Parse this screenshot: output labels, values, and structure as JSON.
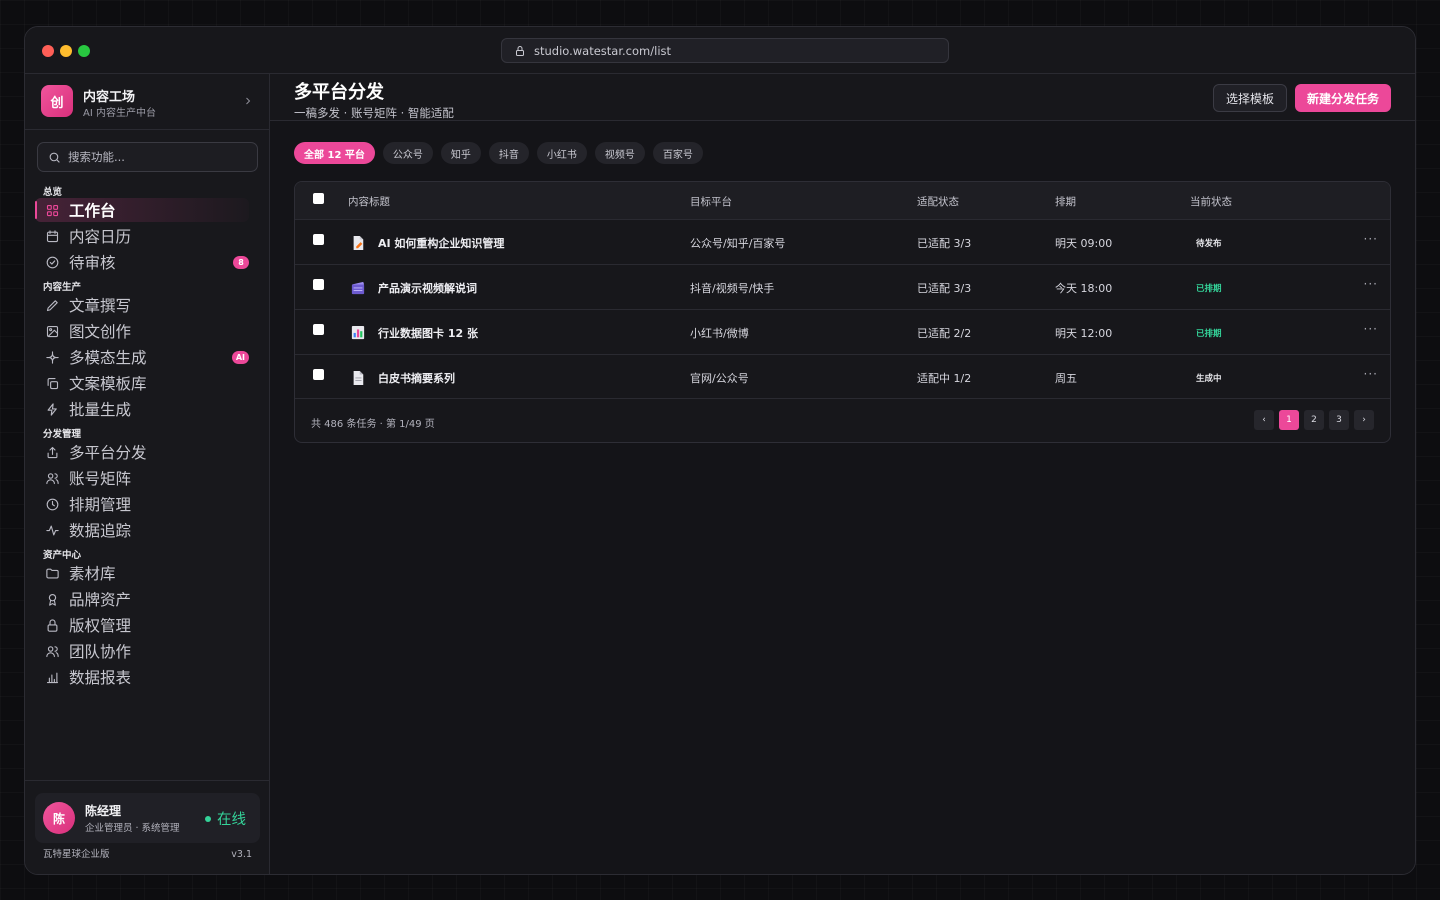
{
  "browser": {
    "url": "studio.watestar.com/list"
  },
  "brand": {
    "logo_char": "创",
    "name": "内容工场",
    "subtitle": "AI 内容生产中台"
  },
  "search": {
    "placeholder": "搜索功能..."
  },
  "nav": {
    "groups": [
      {
        "label": "总览",
        "items": [
          {
            "label": "工作台",
            "icon": "grid-icon",
            "active": true
          },
          {
            "label": "内容日历",
            "icon": "calendar-icon"
          },
          {
            "label": "待审核",
            "icon": "check-circle-icon",
            "badge": "8"
          }
        ]
      },
      {
        "label": "内容生产",
        "items": [
          {
            "label": "文章撰写",
            "icon": "pen-icon"
          },
          {
            "label": "图文创作",
            "icon": "image-icon"
          },
          {
            "label": "多模态生成",
            "icon": "sparkle-icon",
            "badge": "AI"
          },
          {
            "label": "文案模板库",
            "icon": "copy-icon"
          },
          {
            "label": "批量生成",
            "icon": "bolt-icon"
          }
        ]
      },
      {
        "label": "分发管理",
        "items": [
          {
            "label": "多平台分发",
            "icon": "share-icon"
          },
          {
            "label": "账号矩阵",
            "icon": "users-icon"
          },
          {
            "label": "排期管理",
            "icon": "clock-icon"
          },
          {
            "label": "数据追踪",
            "icon": "activity-icon"
          }
        ]
      },
      {
        "label": "资产中心",
        "items": [
          {
            "label": "素材库",
            "icon": "folder-icon"
          },
          {
            "label": "品牌资产",
            "icon": "award-icon"
          },
          {
            "label": "版权管理",
            "icon": "lock-icon"
          },
          {
            "label": "团队协作",
            "icon": "users-icon"
          },
          {
            "label": "数据报表",
            "icon": "bar-chart-icon"
          }
        ]
      }
    ]
  },
  "user": {
    "avatar_char": "陈",
    "name": "陈经理",
    "role": "企业管理员 · 系统管理",
    "status": "在线"
  },
  "footer": {
    "edition": "瓦特星球企业版",
    "version": "v3.1"
  },
  "page": {
    "title": "多平台分发",
    "subtitle": "一稿多发 · 账号矩阵 · 智能适配",
    "btn_template": "选择模板",
    "btn_new": "新建分发任务"
  },
  "filters": [
    "全部 12 平台",
    "公众号",
    "知乎",
    "抖音",
    "小红书",
    "视频号",
    "百家号"
  ],
  "table": {
    "columns": [
      "内容标题",
      "目标平台",
      "适配状态",
      "排期",
      "当前状态"
    ],
    "rows": [
      {
        "icon": "document-pen-icon",
        "title": "AI 如何重构企业知识管理",
        "platforms": "公众号/知乎/百家号",
        "adapt": "已适配 3/3",
        "schedule": "明天 09:00",
        "status": "待发布",
        "status_color": "#e6e6ea"
      },
      {
        "icon": "clapperboard-icon",
        "title": "产品演示视频解说词",
        "platforms": "抖音/视频号/快手",
        "adapt": "已适配 3/3",
        "schedule": "今天 18:00",
        "status": "已排期",
        "status_color": "#34d399"
      },
      {
        "icon": "bar-chart-icon",
        "title": "行业数据图卡 12 张",
        "platforms": "小红书/微博",
        "adapt": "已适配 2/2",
        "schedule": "明天 12:00",
        "status": "已排期",
        "status_color": "#34d399"
      },
      {
        "icon": "document-icon",
        "title": "白皮书摘要系列",
        "platforms": "官网/公众号",
        "adapt": "适配中 1/2",
        "schedule": "周五",
        "status": "生成中",
        "status_color": "#e6e6ea"
      }
    ],
    "footer_text": "共 486 条任务 · 第 1/49 页",
    "pages": [
      "‹",
      "1",
      "2",
      "3",
      "›"
    ],
    "current_page": "1"
  },
  "colors": {
    "accent": "#ec4899",
    "success": "#34d399"
  }
}
